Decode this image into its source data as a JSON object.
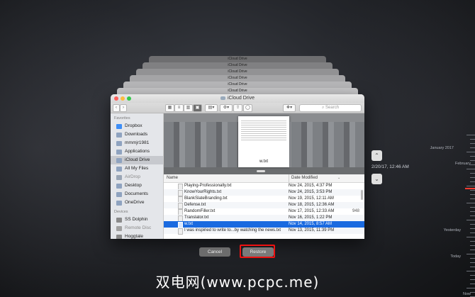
{
  "window": {
    "title": "iCloud Drive",
    "stack_titles": [
      "iCloud Drive",
      "iCloud Drive",
      "iCloud Drive",
      "iCloud Drive",
      "iCloud Drive",
      "iCloud Drive"
    ]
  },
  "toolbar": {
    "search_placeholder": "Search",
    "back": "‹",
    "forward": "›"
  },
  "sidebar": {
    "favorites_label": "Favorites",
    "devices_label": "Devices",
    "favorites": [
      {
        "label": "Dropbox",
        "icon": "dropbox-icon",
        "color": "#3d8ef7"
      },
      {
        "label": "Downloads",
        "icon": "downloads-icon",
        "color": "#8fa3c0"
      },
      {
        "label": "mmmjr1981",
        "icon": "home-icon",
        "color": "#8fa3c0"
      },
      {
        "label": "Applications",
        "icon": "applications-icon",
        "color": "#8fa3c0"
      },
      {
        "label": "iCloud Drive",
        "icon": "cloud-icon",
        "color": "#8fa3c0",
        "selected": true
      },
      {
        "label": "All My Files",
        "icon": "all-files-icon",
        "color": "#8fa3c0"
      },
      {
        "label": "AirDrop",
        "icon": "airdrop-icon",
        "color": "#9aa6b6",
        "dim": true
      },
      {
        "label": "Desktop",
        "icon": "desktop-icon",
        "color": "#8fa3c0"
      },
      {
        "label": "Documents",
        "icon": "documents-icon",
        "color": "#8fa3c0"
      },
      {
        "label": "OneDrive",
        "icon": "onedrive-icon",
        "color": "#8fa3c0"
      }
    ],
    "devices": [
      {
        "label": "SS Dolphin",
        "icon": "disk-icon",
        "color": "#8a8a8a"
      },
      {
        "label": "Remote Disc",
        "icon": "remote-disc-icon",
        "color": "#a0a0a0",
        "dim": true
      },
      {
        "label": "Hoggtale",
        "icon": "disk-icon",
        "color": "#8a8a8a"
      }
    ]
  },
  "preview": {
    "file_name": "w.txt"
  },
  "list": {
    "col_name": "Name",
    "col_date": "Date Modified",
    "rows": [
      {
        "name": "Playing-Professionally.txt",
        "date": "Nov 24, 2015, 4:37 PM",
        "size": ""
      },
      {
        "name": "KnowYourRights.txt",
        "date": "Nov 24, 2015, 3:53 PM",
        "size": ""
      },
      {
        "name": "BlankSlateBranding.txt",
        "date": "Nov 19, 2015, 12:11 AM",
        "size": ""
      },
      {
        "name": "Defense.txt",
        "date": "Nov 18, 2015, 12:36 AM",
        "size": ""
      },
      {
        "name": "RandomFiller.txt",
        "date": "Nov 17, 2015, 12:33 AM",
        "size": "948"
      },
      {
        "name": "Translator.txt",
        "date": "Nov 16, 2015, 1:22 PM",
        "size": ""
      },
      {
        "name": "w.txt",
        "date": "Nov 14, 2015, 8:57 AM",
        "size": "",
        "selected": true
      },
      {
        "name": "I was inspiried to write to...by watching the news.txt",
        "date": "Nov 13, 2015, 11:39 PM",
        "size": ""
      }
    ]
  },
  "buttons": {
    "cancel": "Cancel",
    "restore": "Restore"
  },
  "navigation": {
    "date": "2/20/17, 12:46 AM",
    "up": "⌃",
    "down": "⌄"
  },
  "timeline": {
    "labels": [
      "January 2017",
      "February",
      "Yesterday",
      "Today",
      "Now"
    ]
  },
  "watermark": "双电网(www.pcpc.me)"
}
